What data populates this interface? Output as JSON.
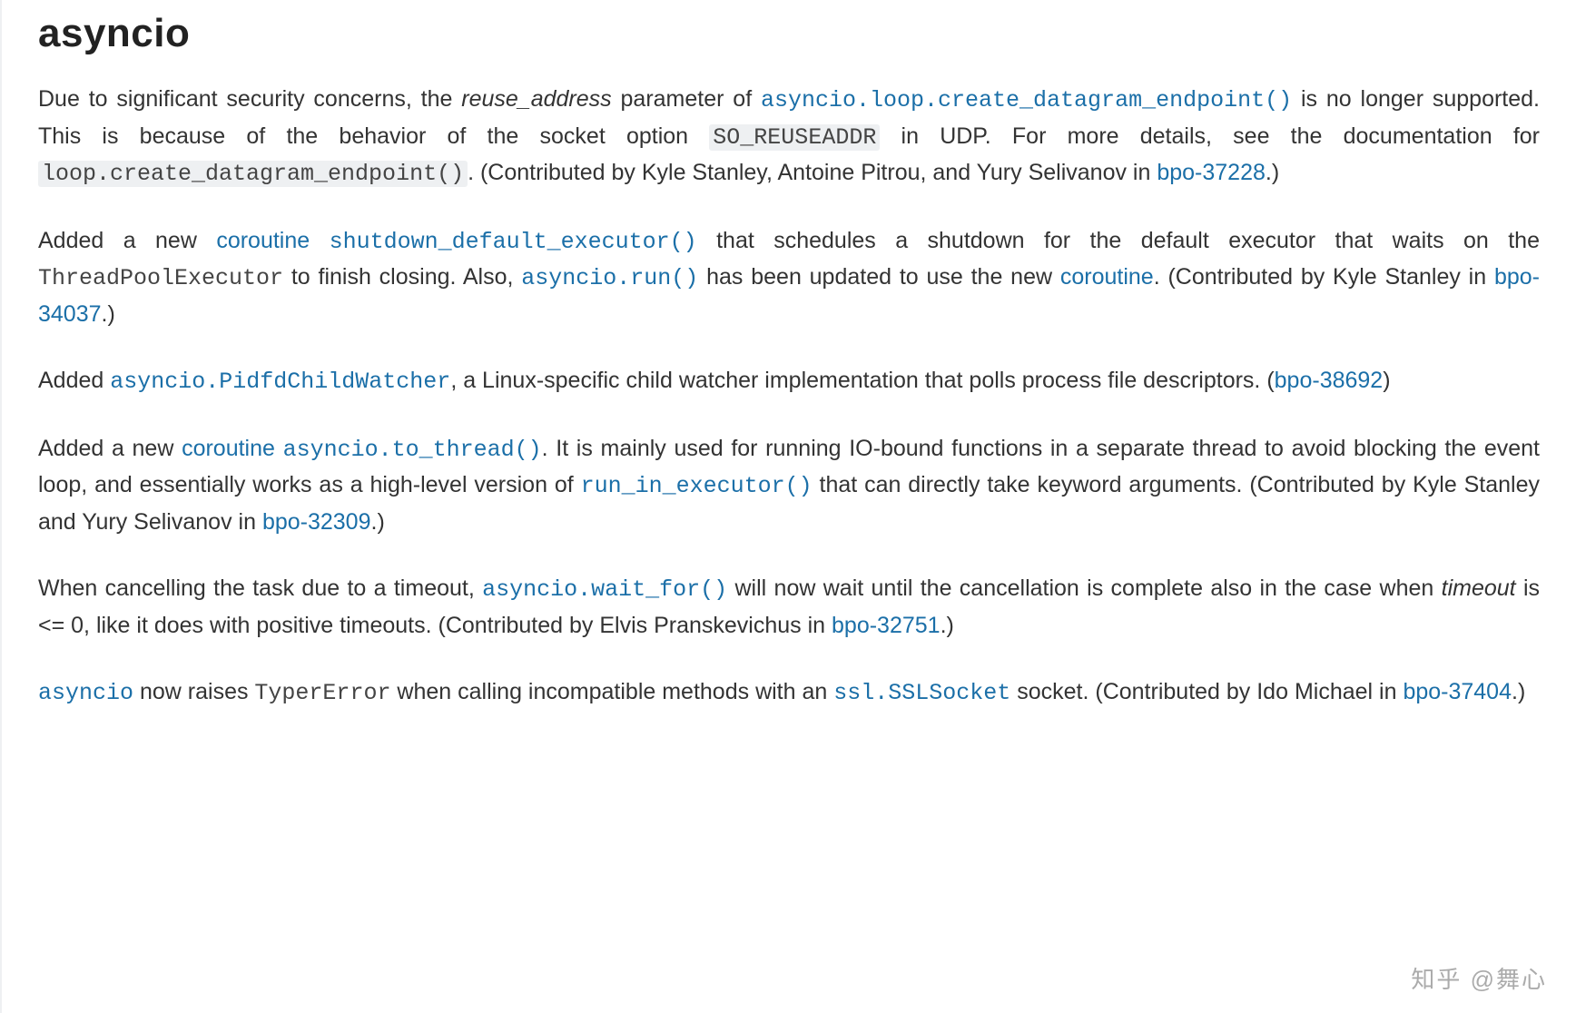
{
  "heading": "asyncio",
  "p1": {
    "t1": "Due to significant security concerns, the ",
    "italic1": "reuse_address",
    "t2": " parameter of ",
    "code1": "asyncio.loop.create_datagram_endpoint()",
    "t3": " is no longer supported. This is because of the behavior of the socket option ",
    "code2": "SO_REUSEADDR",
    "t4": " in UDP. For more details, see the documentation for ",
    "code3": "loop.create_datagram_endpoint()",
    "t5": ". (Contributed by Kyle Stanley, Antoine Pitrou, and Yury Selivanov in ",
    "link1": "bpo-37228",
    "t6": ".)"
  },
  "p2": {
    "t1": "Added a new ",
    "link1": "coroutine",
    "sp1": " ",
    "code1": "shutdown_default_executor()",
    "t2": " that schedules a shutdown for the default executor that waits on the ",
    "code2": "ThreadPoolExecutor",
    "t3": " to finish closing. Also, ",
    "code3": "asyncio.run()",
    "t4": " has been updated to use the new ",
    "link2": "coroutine",
    "t5": ". (Contributed by Kyle Stanley in ",
    "link3": "bpo-34037",
    "t6": ".)"
  },
  "p3": {
    "t1": "Added ",
    "code1": "asyncio.PidfdChildWatcher",
    "t2": ", a Linux-specific child watcher implementation that polls process file descriptors. (",
    "link1": "bpo-38692",
    "t3": ")"
  },
  "p4": {
    "t1": "Added a new ",
    "link1": "coroutine",
    "sp1": " ",
    "code1": "asyncio.to_thread()",
    "t2": ". It is mainly used for running IO-bound functions in a separate thread to avoid blocking the event loop, and essentially works as a high-level version of ",
    "code2": "run_in_executor()",
    "t3": " that can directly take keyword arguments. (Contributed by Kyle Stanley and Yury Selivanov in ",
    "link2": "bpo-32309",
    "t4": ".)"
  },
  "p5": {
    "t1": "When cancelling the task due to a timeout, ",
    "code1": "asyncio.wait_for()",
    "t2": " will now wait until the cancellation is complete also in the case when ",
    "italic1": "timeout",
    "t3": " is <= 0, like it does with positive timeouts. (Contributed by Elvis Pranskevichus in ",
    "link1": "bpo-32751",
    "t4": ".)"
  },
  "p6": {
    "code1": "asyncio",
    "t1": " now raises ",
    "code2": "TyperError",
    "t2": " when calling incompatible methods with an ",
    "code3": "ssl.SSLSocket",
    "t3": " socket. (Contributed by Ido Michael in ",
    "link1": "bpo-37404",
    "t4": ".)"
  },
  "watermark": "知乎 @舞心"
}
